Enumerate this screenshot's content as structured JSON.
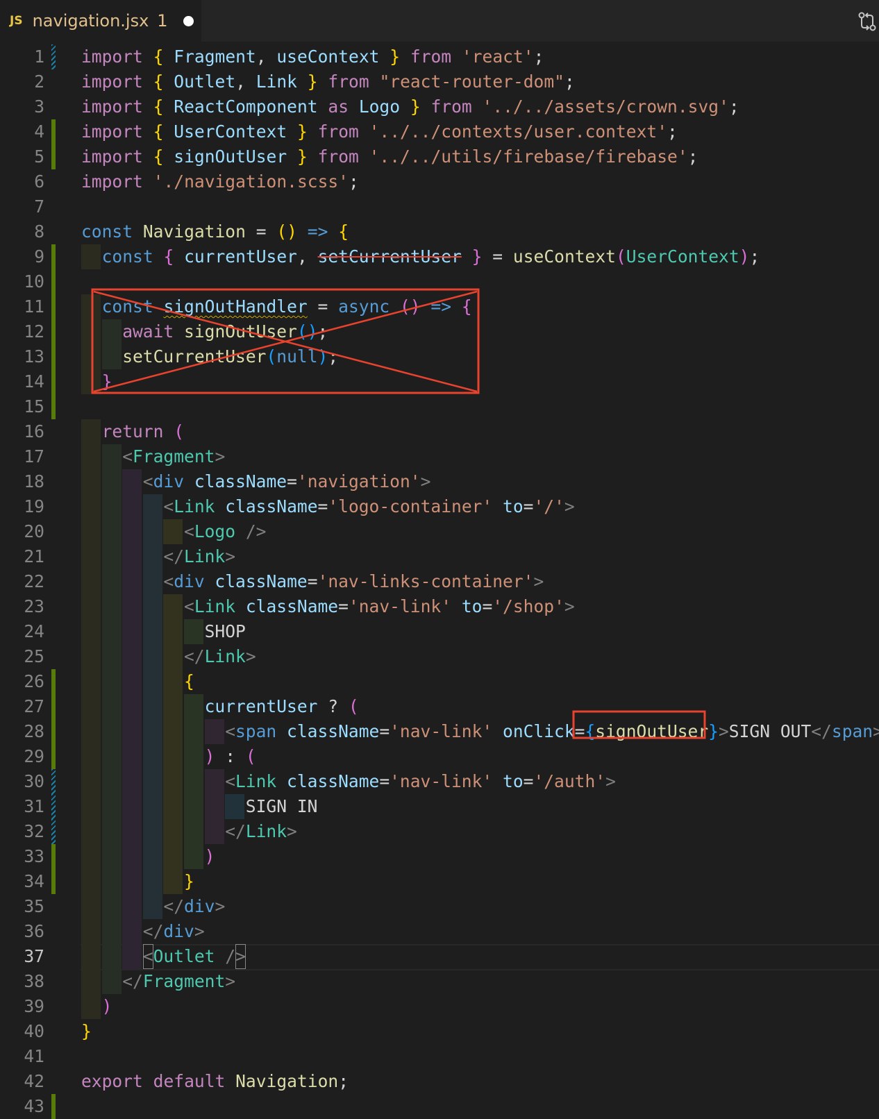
{
  "tab": {
    "icon_text": "JS",
    "filename": "navigation.jsx",
    "problem_count": "1"
  },
  "editor": {
    "active_line": 37,
    "lines": [
      {
        "n": 1,
        "gutter": "mod",
        "depth": 0,
        "tokens": [
          [
            "kw2",
            "import "
          ],
          [
            "br1",
            "{ "
          ],
          [
            "var",
            "Fragment"
          ],
          [
            "txt",
            ", "
          ],
          [
            "var",
            "useContext"
          ],
          [
            "br1",
            " }"
          ],
          [
            "kw2",
            " from "
          ],
          [
            "str",
            "'react'"
          ],
          [
            "txt",
            ";"
          ]
        ]
      },
      {
        "n": 2,
        "gutter": "",
        "depth": 0,
        "tokens": [
          [
            "kw2",
            "import "
          ],
          [
            "br1",
            "{ "
          ],
          [
            "var",
            "Outlet"
          ],
          [
            "txt",
            ", "
          ],
          [
            "var",
            "Link"
          ],
          [
            "br1",
            " }"
          ],
          [
            "kw2",
            " from "
          ],
          [
            "str",
            "\"react-router-dom\""
          ],
          [
            "txt",
            ";"
          ]
        ]
      },
      {
        "n": 3,
        "gutter": "",
        "depth": 0,
        "tokens": [
          [
            "kw2",
            "import "
          ],
          [
            "br1",
            "{ "
          ],
          [
            "var",
            "ReactComponent"
          ],
          [
            "kw2",
            " as "
          ],
          [
            "var",
            "Logo"
          ],
          [
            "br1",
            " }"
          ],
          [
            "kw2",
            " from "
          ],
          [
            "str",
            "'../../assets/crown.svg'"
          ],
          [
            "txt",
            ";"
          ]
        ]
      },
      {
        "n": 4,
        "gutter": "add",
        "depth": 0,
        "tokens": [
          [
            "kw2",
            "import "
          ],
          [
            "br1",
            "{ "
          ],
          [
            "var",
            "UserContext"
          ],
          [
            "br1",
            " }"
          ],
          [
            "kw2",
            " from "
          ],
          [
            "str",
            "'../../contexts/user.context'"
          ],
          [
            "txt",
            ";"
          ]
        ]
      },
      {
        "n": 5,
        "gutter": "add",
        "depth": 0,
        "tokens": [
          [
            "kw2",
            "import "
          ],
          [
            "br1",
            "{ "
          ],
          [
            "var",
            "signOutUser"
          ],
          [
            "br1",
            " }"
          ],
          [
            "kw2",
            " from "
          ],
          [
            "str",
            "'../../utils/firebase/firebase'"
          ],
          [
            "txt",
            ";"
          ]
        ]
      },
      {
        "n": 6,
        "gutter": "",
        "depth": 0,
        "tokens": [
          [
            "kw2",
            "import "
          ],
          [
            "str",
            "'./navigation.scss'"
          ],
          [
            "txt",
            ";"
          ]
        ]
      },
      {
        "n": 7,
        "gutter": "",
        "depth": 0,
        "tokens": []
      },
      {
        "n": 8,
        "gutter": "",
        "depth": 0,
        "tokens": [
          [
            "kw",
            "const "
          ],
          [
            "fn",
            "Navigation"
          ],
          [
            "txt",
            " = "
          ],
          [
            "br1",
            "()"
          ],
          [
            "kw",
            " => "
          ],
          [
            "br1",
            "{"
          ]
        ]
      },
      {
        "n": 9,
        "gutter": "add",
        "depth": 1,
        "tokens": [
          [
            "kw",
            "const "
          ],
          [
            "br2",
            "{ "
          ],
          [
            "var",
            "currentUser"
          ],
          [
            "txt",
            ", "
          ],
          [
            "strike",
            "setCurrentUser"
          ],
          [
            "br2",
            " }"
          ],
          [
            "txt",
            " = "
          ],
          [
            "fn",
            "useContext"
          ],
          [
            "br2",
            "("
          ],
          [
            "cls",
            "UserContext"
          ],
          [
            "br2",
            ")"
          ],
          [
            "txt",
            ";"
          ]
        ]
      },
      {
        "n": 10,
        "gutter": "add",
        "depth": 0,
        "tokens": []
      },
      {
        "n": 11,
        "gutter": "add",
        "depth": 1,
        "tokens": [
          [
            "kw",
            "const "
          ],
          [
            "squig",
            "signOutHandler"
          ],
          [
            "txt",
            " = "
          ],
          [
            "kw",
            "async "
          ],
          [
            "br2",
            "()"
          ],
          [
            "kw",
            " => "
          ],
          [
            "br2",
            "{"
          ]
        ]
      },
      {
        "n": 12,
        "gutter": "add",
        "depth": 2,
        "tokens": [
          [
            "kw2",
            "await "
          ],
          [
            "fn",
            "signOutUser"
          ],
          [
            "br3",
            "()"
          ],
          [
            "txt",
            ";"
          ]
        ]
      },
      {
        "n": 13,
        "gutter": "add",
        "depth": 2,
        "tokens": [
          [
            "fn",
            "setCurrentUser"
          ],
          [
            "br3",
            "("
          ],
          [
            "kw",
            "null"
          ],
          [
            "br3",
            ")"
          ],
          [
            "txt",
            ";"
          ]
        ]
      },
      {
        "n": 14,
        "gutter": "add",
        "depth": 1,
        "tokens": [
          [
            "br2",
            "}"
          ]
        ]
      },
      {
        "n": 15,
        "gutter": "add",
        "depth": 0,
        "tokens": []
      },
      {
        "n": 16,
        "gutter": "",
        "depth": 1,
        "tokens": [
          [
            "kw2",
            "return "
          ],
          [
            "br2",
            "("
          ]
        ]
      },
      {
        "n": 17,
        "gutter": "",
        "depth": 2,
        "tokens": [
          [
            "tagp",
            "<"
          ],
          [
            "tag",
            "Fragment"
          ],
          [
            "tagp",
            ">"
          ]
        ]
      },
      {
        "n": 18,
        "gutter": "",
        "depth": 3,
        "tokens": [
          [
            "tagp",
            "<"
          ],
          [
            "htag",
            "div"
          ],
          [
            "attr",
            " className"
          ],
          [
            "txt",
            "="
          ],
          [
            "str",
            "'navigation'"
          ],
          [
            "tagp",
            ">"
          ]
        ]
      },
      {
        "n": 19,
        "gutter": "",
        "depth": 4,
        "tokens": [
          [
            "tagp",
            "<"
          ],
          [
            "tag",
            "Link"
          ],
          [
            "attr",
            " className"
          ],
          [
            "txt",
            "="
          ],
          [
            "str",
            "'logo-container'"
          ],
          [
            "attr",
            " to"
          ],
          [
            "txt",
            "="
          ],
          [
            "str",
            "'/'"
          ],
          [
            "tagp",
            ">"
          ]
        ]
      },
      {
        "n": 20,
        "gutter": "",
        "depth": 5,
        "tokens": [
          [
            "tagp",
            "<"
          ],
          [
            "tag",
            "Logo"
          ],
          [
            "tagp",
            " />"
          ]
        ]
      },
      {
        "n": 21,
        "gutter": "",
        "depth": 4,
        "tokens": [
          [
            "tagp",
            "</"
          ],
          [
            "tag",
            "Link"
          ],
          [
            "tagp",
            ">"
          ]
        ]
      },
      {
        "n": 22,
        "gutter": "",
        "depth": 4,
        "tokens": [
          [
            "tagp",
            "<"
          ],
          [
            "htag",
            "div"
          ],
          [
            "attr",
            " className"
          ],
          [
            "txt",
            "="
          ],
          [
            "str",
            "'nav-links-container'"
          ],
          [
            "tagp",
            ">"
          ]
        ]
      },
      {
        "n": 23,
        "gutter": "",
        "depth": 5,
        "tokens": [
          [
            "tagp",
            "<"
          ],
          [
            "tag",
            "Link"
          ],
          [
            "attr",
            " className"
          ],
          [
            "txt",
            "="
          ],
          [
            "str",
            "'nav-link'"
          ],
          [
            "attr",
            " to"
          ],
          [
            "txt",
            "="
          ],
          [
            "str",
            "'/shop'"
          ],
          [
            "tagp",
            ">"
          ]
        ]
      },
      {
        "n": 24,
        "gutter": "",
        "depth": 6,
        "tokens": [
          [
            "txt",
            "SHOP"
          ]
        ]
      },
      {
        "n": 25,
        "gutter": "",
        "depth": 5,
        "tokens": [
          [
            "tagp",
            "</"
          ],
          [
            "tag",
            "Link"
          ],
          [
            "tagp",
            ">"
          ]
        ]
      },
      {
        "n": 26,
        "gutter": "add",
        "depth": 5,
        "tokens": [
          [
            "br1",
            "{"
          ]
        ]
      },
      {
        "n": 27,
        "gutter": "add",
        "depth": 6,
        "tokens": [
          [
            "var",
            "currentUser"
          ],
          [
            "txt",
            " ? "
          ],
          [
            "br2",
            "("
          ]
        ]
      },
      {
        "n": 28,
        "gutter": "add",
        "depth": 7,
        "tokens": [
          [
            "tagp",
            "<"
          ],
          [
            "htag",
            "span"
          ],
          [
            "attr",
            " className"
          ],
          [
            "txt",
            "="
          ],
          [
            "str",
            "'nav-link'"
          ],
          [
            "attr",
            " onClick"
          ],
          [
            "txt",
            "="
          ],
          [
            "boxstart",
            ""
          ],
          [
            "br3",
            "{"
          ],
          [
            "fn",
            "signOutUser"
          ],
          [
            "br3",
            "}"
          ],
          [
            "boxend",
            ""
          ],
          [
            "tagp",
            ">"
          ],
          [
            "txt",
            "SIGN OUT"
          ],
          [
            "tagp",
            "</"
          ],
          [
            "htag",
            "span"
          ],
          [
            "tagp",
            ">"
          ]
        ]
      },
      {
        "n": 29,
        "gutter": "add",
        "depth": 6,
        "tokens": [
          [
            "br2",
            ")"
          ],
          [
            "txt",
            " : "
          ],
          [
            "br2",
            "("
          ]
        ]
      },
      {
        "n": 30,
        "gutter": "mod",
        "depth": 7,
        "tokens": [
          [
            "tagp",
            "<"
          ],
          [
            "tag",
            "Link"
          ],
          [
            "attr",
            " className"
          ],
          [
            "txt",
            "="
          ],
          [
            "str",
            "'nav-link'"
          ],
          [
            "attr",
            " to"
          ],
          [
            "txt",
            "="
          ],
          [
            "str",
            "'/auth'"
          ],
          [
            "tagp",
            ">"
          ]
        ]
      },
      {
        "n": 31,
        "gutter": "mod",
        "depth": 8,
        "tokens": [
          [
            "txt",
            "SIGN IN"
          ]
        ]
      },
      {
        "n": 32,
        "gutter": "mod",
        "depth": 7,
        "tokens": [
          [
            "tagp",
            "</"
          ],
          [
            "tag",
            "Link"
          ],
          [
            "tagp",
            ">"
          ]
        ]
      },
      {
        "n": 33,
        "gutter": "add",
        "depth": 6,
        "tokens": [
          [
            "br2",
            ")"
          ]
        ]
      },
      {
        "n": 34,
        "gutter": "add",
        "depth": 5,
        "tokens": [
          [
            "br1",
            "}"
          ]
        ]
      },
      {
        "n": 35,
        "gutter": "",
        "depth": 4,
        "tokens": [
          [
            "tagp",
            "</"
          ],
          [
            "htag",
            "div"
          ],
          [
            "tagp",
            ">"
          ]
        ]
      },
      {
        "n": 36,
        "gutter": "",
        "depth": 3,
        "tokens": [
          [
            "tagp",
            "</"
          ],
          [
            "htag",
            "div"
          ],
          [
            "tagp",
            ">"
          ]
        ]
      },
      {
        "n": 37,
        "gutter": "",
        "depth": 3,
        "tokens": [
          [
            "cursorl",
            "<"
          ],
          [
            "tag",
            "Outlet"
          ],
          [
            "tagp",
            " /"
          ],
          [
            "cursorr",
            ">"
          ]
        ]
      },
      {
        "n": 38,
        "gutter": "",
        "depth": 2,
        "tokens": [
          [
            "tagp",
            "</"
          ],
          [
            "tag",
            "Fragment"
          ],
          [
            "tagp",
            ">"
          ]
        ]
      },
      {
        "n": 39,
        "gutter": "",
        "depth": 1,
        "tokens": [
          [
            "br2",
            ")"
          ]
        ]
      },
      {
        "n": 40,
        "gutter": "",
        "depth": 0,
        "tokens": [
          [
            "br1",
            "}"
          ]
        ]
      },
      {
        "n": 41,
        "gutter": "",
        "depth": 0,
        "tokens": []
      },
      {
        "n": 42,
        "gutter": "",
        "depth": 0,
        "tokens": [
          [
            "kw2",
            "export "
          ],
          [
            "kw2",
            "default "
          ],
          [
            "fn",
            "Navigation"
          ],
          [
            "txt",
            ";"
          ]
        ]
      },
      {
        "n": 43,
        "gutter": "add",
        "depth": 0,
        "tokens": []
      }
    ]
  },
  "annotations": {
    "color": "#e8432e"
  },
  "colors": {
    "background": "#1e1e1e",
    "tabbar": "#252526",
    "gutter_added": "#587c0c",
    "gutter_modified": "#1b81a8"
  }
}
